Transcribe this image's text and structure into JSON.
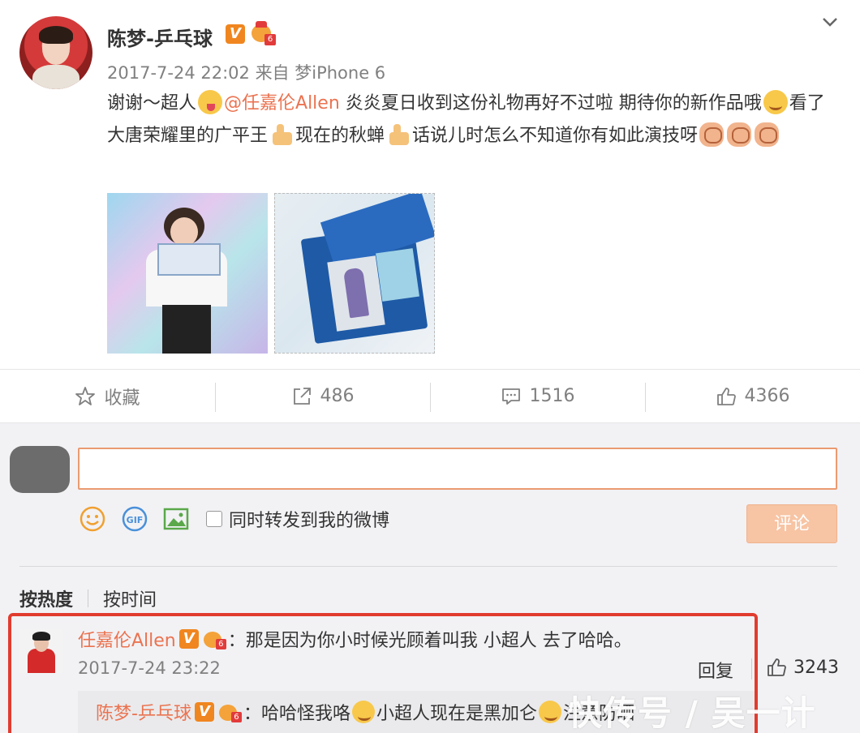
{
  "post": {
    "author": "陈梦-乒乓球",
    "verified_badge": "V",
    "level_badge": "6",
    "time": "2017-7-24 22:02",
    "source_prefix": "来自",
    "source": "梦iPhone 6",
    "text_1": "谢谢～超人",
    "mention": "@任嘉伦Allen",
    "text_2": " 炎炎夏日收到这份礼物再好不过啦 期待你的新作品哦",
    "text_3": "看了大唐荣耀里的广平王",
    "text_4": "现在的秋蝉",
    "text_5": "话说儿时怎么不知道你有如此演技呀",
    "images": [
      "photo-girl-holding-gift",
      "photo-gift-box"
    ]
  },
  "actions": {
    "favorite_label": "收藏",
    "repost_count": "486",
    "comment_count": "1516",
    "like_count": "4366",
    "favorite_icon": "star-icon",
    "repost_icon": "share-icon",
    "comment_icon": "comment-icon",
    "like_icon": "thumbs-up-icon"
  },
  "compose": {
    "input_value": "",
    "repost_checkbox_label": "同时转发到我的微博",
    "submit_label": "评论",
    "tools": [
      "emoji-icon",
      "gif-icon",
      "image-icon"
    ]
  },
  "sort": {
    "hot": "按热度",
    "time": "按时间"
  },
  "comment": {
    "user": "任嘉伦Allen",
    "verified_badge": "V",
    "separator": "：",
    "text": "那是因为你小时候光顾着叫我 小超人 去了哈哈。",
    "time": "2017-7-24 23:22",
    "reply_label": "回复",
    "like_count": "3243"
  },
  "sub_reply": {
    "user": "陈梦-乒乓球",
    "verified_badge": "V",
    "separator": "：",
    "text_1": "哈哈怪我咯",
    "text_2": "小超人现在是黑加仑",
    "text_3": "注意防晒"
  },
  "watermark": "快传号 / 吴一计",
  "colors": {
    "accent": "#eb7350",
    "badge_orange": "#f0861f",
    "highlight_red": "#e13c2f",
    "muted_gray": "#808080",
    "submit_disabled": "#f7c4a4"
  }
}
